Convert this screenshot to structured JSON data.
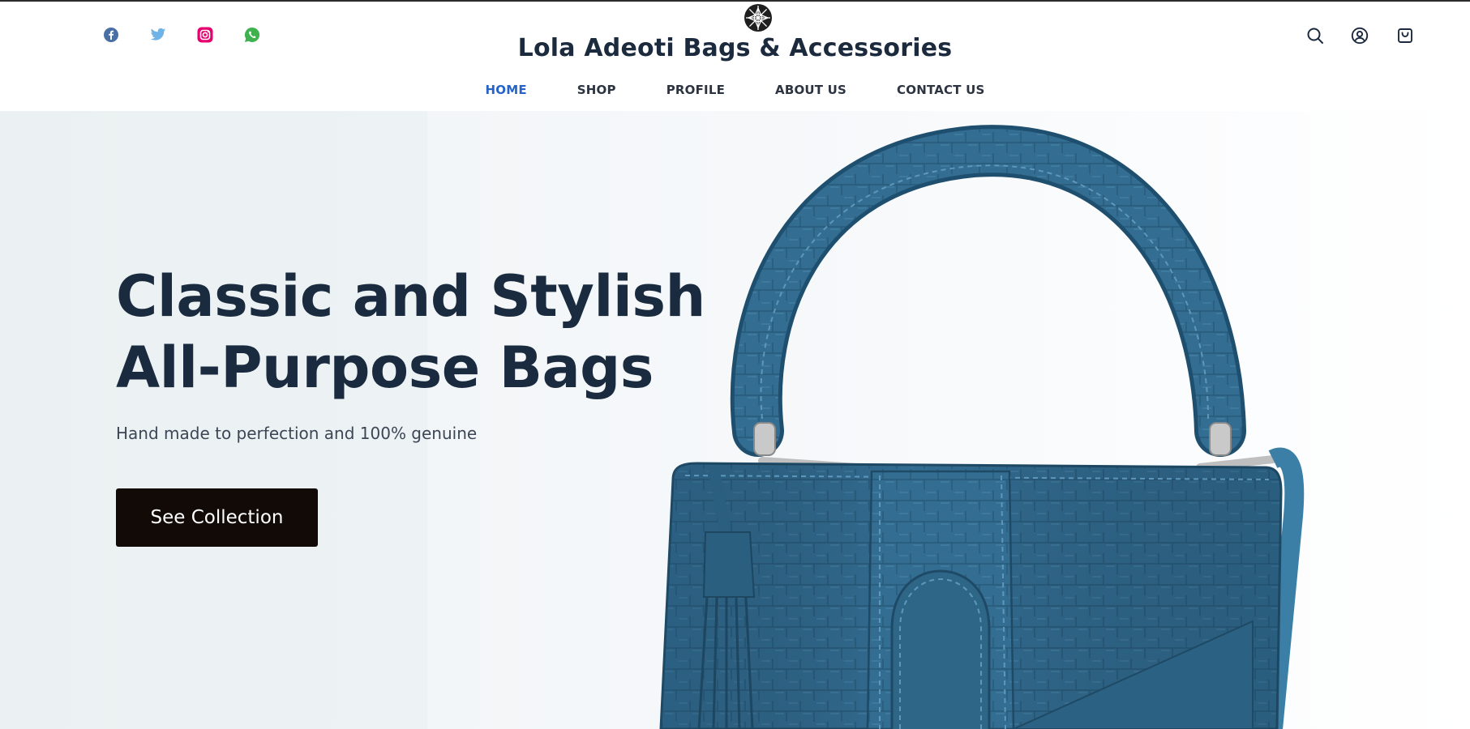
{
  "header": {
    "brand_name": "Lola Adeoti Bags & Accessories",
    "social": [
      {
        "icon": "facebook-icon",
        "color": "#4a6fa5"
      },
      {
        "icon": "twitter-icon",
        "color": "#6fb2e6"
      },
      {
        "icon": "instagram-icon",
        "color": "#e4006e"
      },
      {
        "icon": "whatsapp-icon",
        "color": "#3fb24f"
      }
    ],
    "nav": {
      "items": [
        {
          "label": "HOME",
          "active": true
        },
        {
          "label": "SHOP",
          "active": false
        },
        {
          "label": "PROFILE",
          "active": false
        },
        {
          "label": "ABOUT US",
          "active": false
        },
        {
          "label": "CONTACT US",
          "active": false
        }
      ],
      "active_color": "#2563c9"
    },
    "actions": [
      {
        "icon": "search-icon"
      },
      {
        "icon": "account-icon"
      },
      {
        "icon": "cart-icon"
      }
    ]
  },
  "hero": {
    "title": "Classic and Stylish All-Purpose Bags",
    "subtitle": "Hand made to perfection and 100% genuine",
    "cta_label": "See Collection",
    "image": "blue-croc-leather-handbag"
  },
  "colors": {
    "text_dark": "#1c2a3d",
    "cta_bg": "#120a07",
    "bag_blue": "#2f6a8f"
  }
}
